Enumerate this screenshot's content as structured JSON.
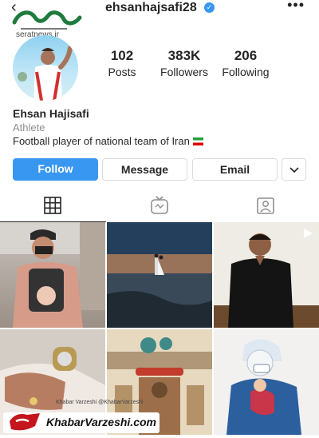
{
  "header": {
    "back_icon": "chevron-left-icon",
    "username": "ehsanhajsafi28",
    "verified_icon": "verified-badge-icon",
    "more_icon": "more-options-icon"
  },
  "watermark": {
    "site": "seratnews.ir",
    "logo_text": "صراط"
  },
  "profile": {
    "name": "Ehsan Hajisafi",
    "category": "Athlete",
    "bio": "Football player of national team of Iran",
    "bio_flag_icon": "iran-flag-icon"
  },
  "stats": [
    {
      "value": "102",
      "label": "Posts"
    },
    {
      "value": "383K",
      "label": "Followers"
    },
    {
      "value": "206",
      "label": "Following"
    }
  ],
  "actions": {
    "follow": "Follow",
    "message": "Message",
    "email": "Email",
    "chevron_icon": "chevron-down-icon"
  },
  "tabs": [
    {
      "name": "grid",
      "icon": "grid-icon",
      "active": true
    },
    {
      "name": "igtv",
      "icon": "igtv-icon",
      "active": false
    },
    {
      "name": "tagged",
      "icon": "tagged-person-icon",
      "active": false
    }
  ],
  "posts": [
    {
      "subject": "man carrying baby"
    },
    {
      "subject": "couple at sunset by the water"
    },
    {
      "subject": "man in black shirt",
      "type_icon": "video-play-icon"
    },
    {
      "subject": "hands with watch and baby"
    },
    {
      "subject": "persian illustration"
    },
    {
      "subject": "nurse illustration"
    }
  ],
  "overlay": {
    "small_text": "Khabar Varzeshi @KhabarVarzeshi",
    "brand": "KhabarVarzeshi.com",
    "colors": {
      "accent": "#c4161c",
      "follow": "#3897f0"
    }
  }
}
